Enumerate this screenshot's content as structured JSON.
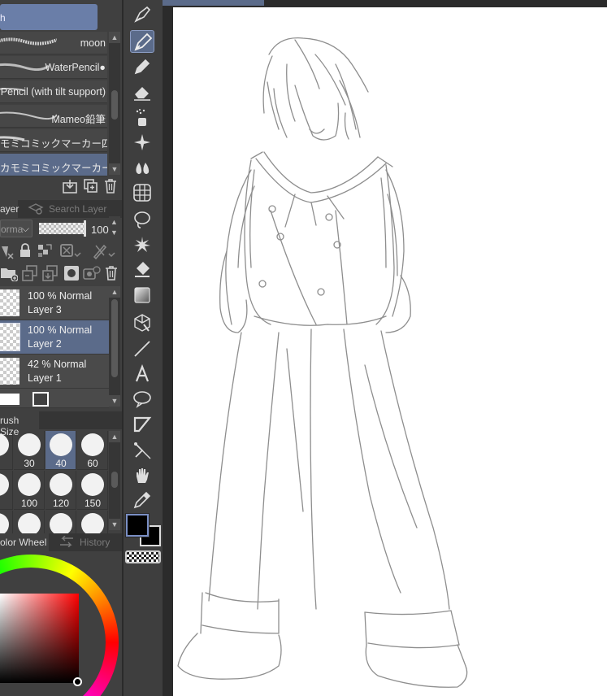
{
  "brush_panel": {
    "header_label": "h",
    "items": [
      {
        "label": "moon",
        "selected": false
      },
      {
        "label": "WaterPencil●",
        "selected": false
      },
      {
        "label": "Pencil (with tilt support)",
        "selected": false
      },
      {
        "label": "Mameo鉛筆",
        "selected": false
      },
      {
        "label": "モミコミックマーカー四角",
        "selected": false
      },
      {
        "label": "カモミコミックマーカー丸",
        "selected": true
      }
    ]
  },
  "layer_panel": {
    "tabs": [
      {
        "label": "ayer",
        "active": true
      },
      {
        "label": "Search Layer",
        "active": false
      }
    ],
    "blend_mode": "orma",
    "opacity": "100",
    "layers": [
      {
        "opacity_mode": "100 % Normal",
        "name": "Layer 3",
        "selected": false
      },
      {
        "opacity_mode": "100 % Normal",
        "name": "Layer 2",
        "selected": true
      },
      {
        "opacity_mode": "42 % Normal",
        "name": "Layer 1",
        "selected": false
      }
    ]
  },
  "brush_size_panel": {
    "tab_label": "rush Size",
    "rows": [
      [
        {
          "size": "",
          "selected": false
        },
        {
          "size": "30",
          "selected": false
        },
        {
          "size": "40",
          "selected": true
        },
        {
          "size": "60",
          "selected": false
        }
      ],
      [
        {
          "size": "",
          "selected": false
        },
        {
          "size": "100",
          "selected": false
        },
        {
          "size": "120",
          "selected": false
        },
        {
          "size": "150",
          "selected": false
        }
      ],
      [
        {
          "size": "",
          "selected": false
        },
        {
          "size": "",
          "selected": false
        },
        {
          "size": "",
          "selected": false
        },
        {
          "size": "",
          "selected": false
        }
      ]
    ]
  },
  "color_panel": {
    "tabs": [
      {
        "label": "olor Wheel",
        "active": true
      },
      {
        "label": "History",
        "active": false
      }
    ],
    "main_color": "#000000",
    "sub_color": "#000000"
  },
  "toolbar": {
    "tools": [
      {
        "icon": "pen-nib-icon",
        "selected": false
      },
      {
        "icon": "pen-icon",
        "selected": true
      },
      {
        "icon": "pencil-icon",
        "selected": false
      },
      {
        "icon": "eraser-icon",
        "selected": false
      },
      {
        "icon": "spray-icon",
        "selected": false
      },
      {
        "icon": "sparkle-decoration-icon",
        "selected": false
      },
      {
        "icon": "blend-drops-icon",
        "selected": false
      },
      {
        "icon": "perspective-grid-icon",
        "selected": false
      },
      {
        "icon": "lasso-icon",
        "selected": false
      },
      {
        "icon": "auto-select-wand-icon",
        "selected": false
      },
      {
        "icon": "fill-bucket-icon",
        "selected": false
      },
      {
        "icon": "gradient-icon",
        "selected": false
      },
      {
        "icon": "3d-object-icon",
        "selected": false
      },
      {
        "icon": "line-icon",
        "selected": false
      },
      {
        "icon": "text-icon",
        "selected": false
      },
      {
        "icon": "balloon-icon",
        "selected": false
      },
      {
        "icon": "frame-border-icon",
        "selected": false
      },
      {
        "icon": "correct-line-icon",
        "selected": false
      },
      {
        "icon": "hand-icon",
        "selected": false
      },
      {
        "icon": "eyedropper-icon",
        "selected": false
      }
    ]
  },
  "colors": {
    "accent": "#5b6b8a",
    "panel": "#404040",
    "toolbar": "#3e3e3e"
  }
}
